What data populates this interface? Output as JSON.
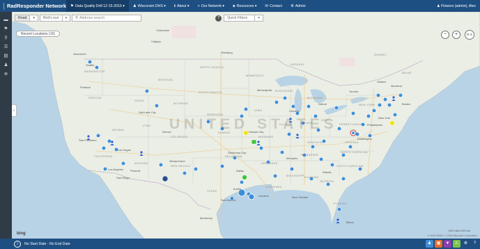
{
  "brand": {
    "name": "RadResponder Network"
  },
  "nav": {
    "items": [
      {
        "icon": "⚑",
        "label": "Data Quality Drill 12-15-2015 ▾"
      },
      {
        "icon": "♟",
        "label": "Wisconsin DHS ▾"
      },
      {
        "icon": "ℹ",
        "label": "About ▾"
      },
      {
        "icon": "<",
        "label": "Our Network ▾"
      },
      {
        "icon": "♣",
        "label": "Resources ▾"
      },
      {
        "icon": "✉",
        "label": "Contact"
      },
      {
        "icon": "⚙",
        "label": "Admin"
      }
    ],
    "user": "♟ Flowers (admin), Alex"
  },
  "toolbar": {
    "road": "Road",
    "birdseye": "Bird's eye",
    "dropdown": "▾",
    "address_placeholder": "Address search",
    "help": "?",
    "quick_filters": "Quick Filters",
    "qf_caret": "▾"
  },
  "map": {
    "recent_button": "Recent Locations (10)",
    "country_label": "UNITED STATES",
    "controls": {
      "zoom_out": "−",
      "zoom_in": "+",
      "compass": "N S"
    },
    "bing": "bing",
    "scale": "200 miles   200 km",
    "copyright": "© 2016 HERE, © 2016 Microsoft Corporation",
    "places": [
      "Vancouver",
      "Seattle",
      "Portland",
      "Salt Lake City",
      "San Francisco",
      "Las Vegas",
      "Los Angeles",
      "San Diego",
      "Denver",
      "Phoenix",
      "Albuquerque",
      "Dallas",
      "Houston",
      "San Antonio",
      "Austin",
      "Oklahoma City",
      "Kansas City",
      "Minneapolis",
      "Chicago",
      "Detroit",
      "Toronto",
      "Ottawa",
      "Montreal",
      "New York",
      "Boston",
      "Philadelphia",
      "Washington",
      "Atlanta",
      "Memphis",
      "New Orleans",
      "Miami",
      "Monterrey",
      "Winnipeg",
      "Calgary",
      "Edmonton"
    ],
    "states": [
      "WASHINGTON",
      "OREGON",
      "CALIFORNIA",
      "NEVADA",
      "IDAHO",
      "MONTANA",
      "WYOMING",
      "UTAH",
      "COLORADO",
      "ARIZONA",
      "NEW MEXICO",
      "NORTH DAKOTA",
      "SOUTH DAKOTA",
      "NEBRASKA",
      "KANSAS",
      "OKLAHOMA",
      "TEXAS",
      "MINNESOTA",
      "IOWA",
      "MISSOURI",
      "ARKANSAS",
      "LOUISIANA",
      "WISCONSIN",
      "ILLINOIS",
      "MICHIGAN",
      "INDIANA",
      "OHIO",
      "KENTUCKY",
      "TENNESSEE",
      "MISSISSIPPI",
      "ALABAMA",
      "GEORGIA",
      "FLORIDA",
      "SOUTH CAROLINA",
      "NORTH CAROLINA",
      "VIRGINIA",
      "PENNSYLVANIA",
      "NEW YORK",
      "MAINE",
      "ONTARIO",
      "QUEBEC"
    ]
  },
  "colors": {
    "nav": "#1e4f82",
    "sidebar": "#2f3b47",
    "water": "#b9d3e6",
    "land": "#eaeee4",
    "marker_blue": "#3e8ed8",
    "person_blue": "#2a5bd8",
    "marker_yellow": "#f2e31c",
    "marker_green": "#3fc43f"
  },
  "sidebar": {
    "icons": [
      "car-icon",
      "flag-icon",
      "pin-icon",
      "list-icon",
      "document-icon",
      "people-icon",
      "add-icon"
    ]
  },
  "bottom": {
    "info": "i",
    "date_range": "No Start Date - No End Date"
  }
}
